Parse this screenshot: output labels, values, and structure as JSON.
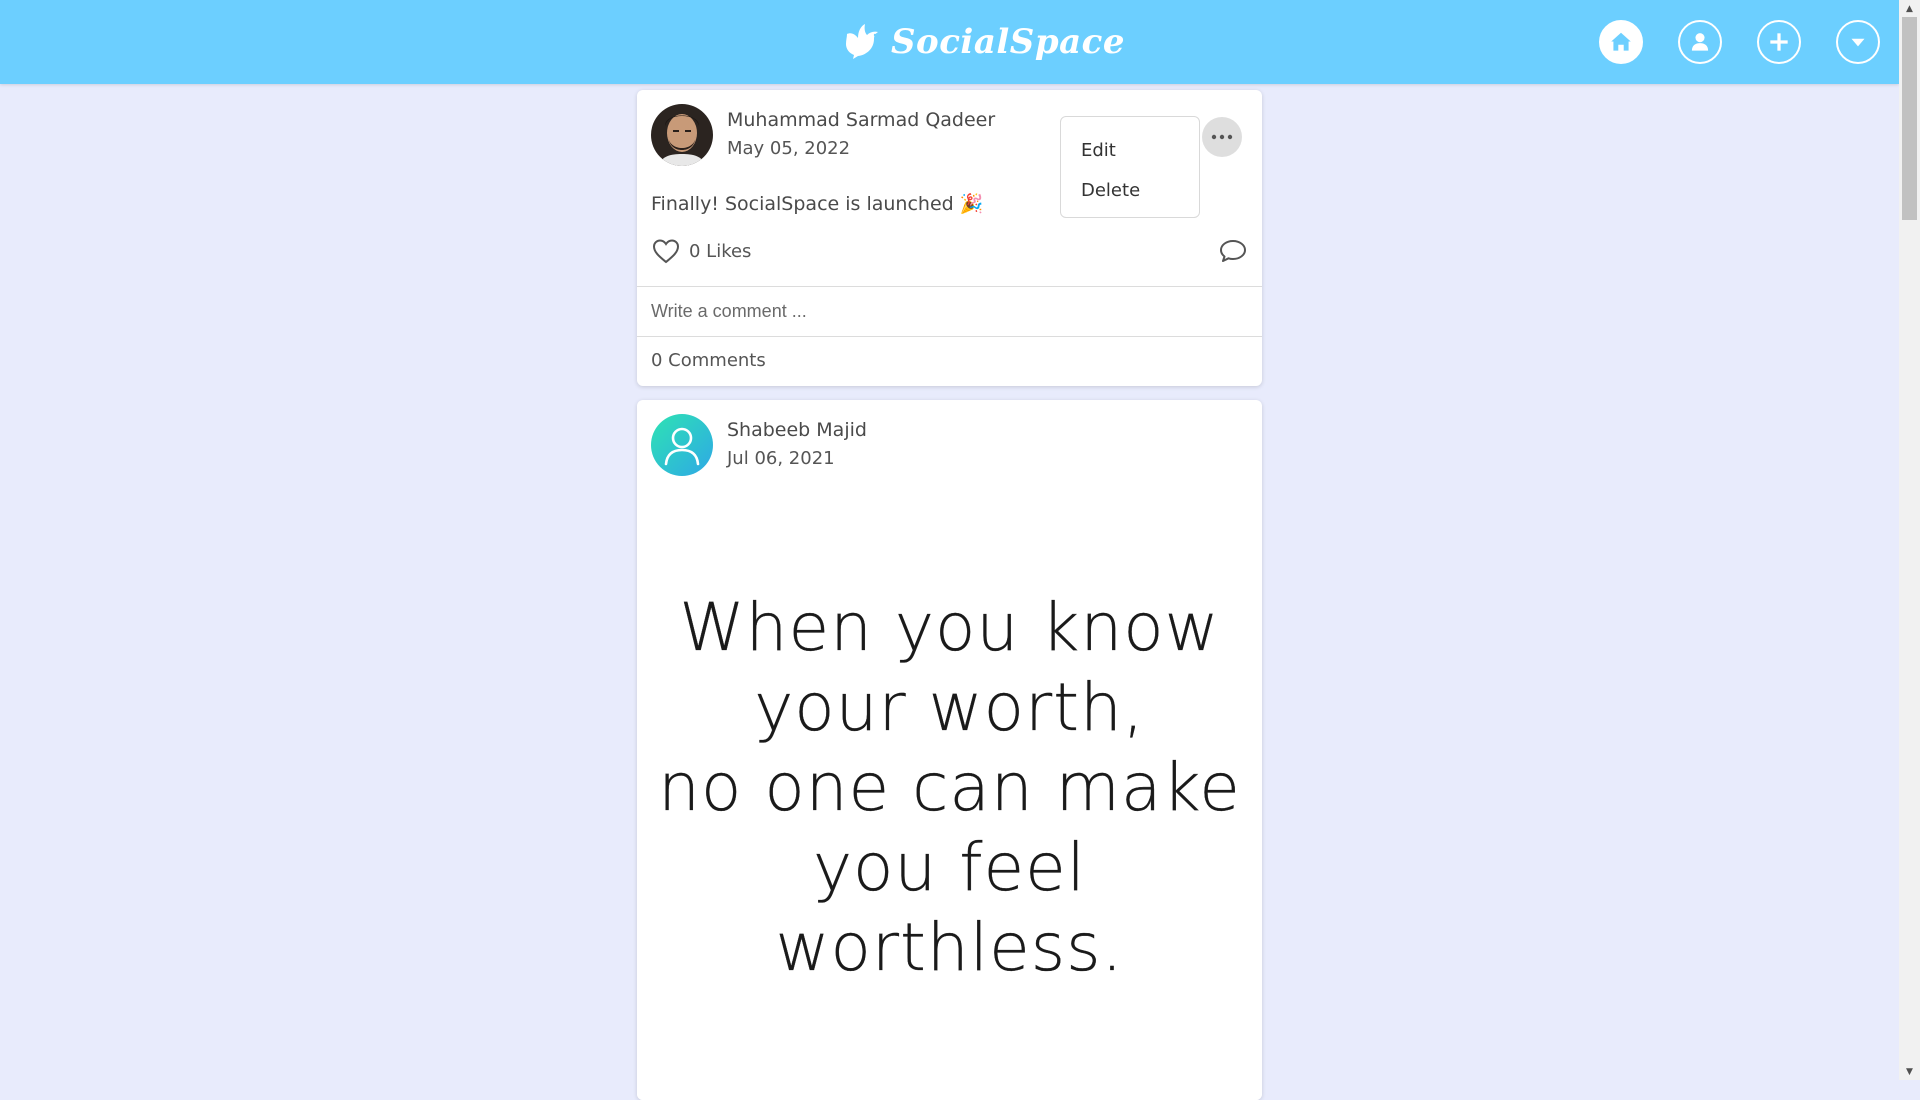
{
  "app": {
    "brand_name": "SocialSpace",
    "accent_color": "#6ccfff",
    "background_color": "#e8ebfc"
  },
  "nav": {
    "icons": [
      "home-icon",
      "profile-icon",
      "add-icon",
      "dropdown-icon"
    ]
  },
  "posts": [
    {
      "author": "Muhammad Sarmad Qadeer",
      "date": "May 05, 2022",
      "text": "Finally! SocialSpace is launched 🎉",
      "likes_label": "0 Likes",
      "comment_placeholder": "Write a comment ...",
      "comments_label": "0 Comments",
      "menu": {
        "edit_label": "Edit",
        "delete_label": "Delete"
      }
    },
    {
      "author": "Shabeeb Majid",
      "date": "Jul 06, 2021",
      "image_text_lines": [
        "When you know",
        "your worth,",
        "no one can make",
        "you feel",
        "worthless."
      ]
    }
  ]
}
